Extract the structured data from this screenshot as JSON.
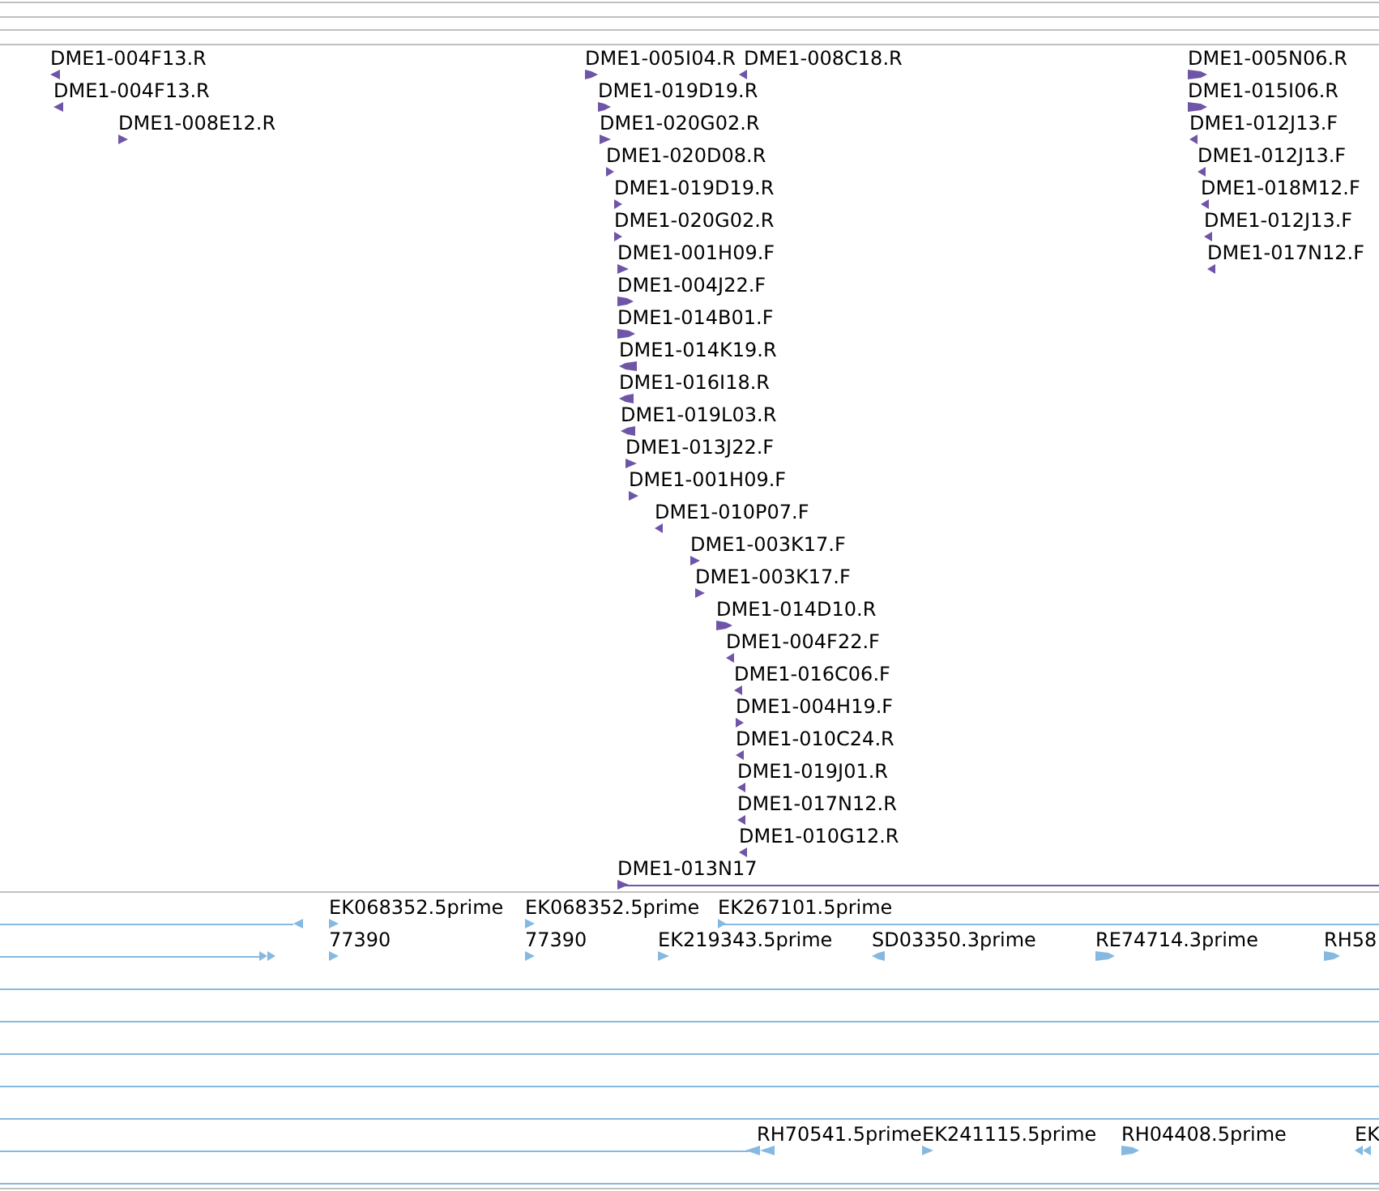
{
  "tracks": [
    {
      "kind": "clone_ends",
      "features": [
        {
          "label": "DME1-004F13.R",
          "reverse": true
        },
        {
          "label": "DME1-005I04.R",
          "reverse": false
        },
        {
          "label": "DME1-008C18.R",
          "reverse": true
        },
        {
          "label": "DME1-005N06.R",
          "reverse": false
        },
        {
          "label": "DME1-004F13.R",
          "reverse": true
        },
        {
          "label": "DME1-019D19.R",
          "reverse": false
        },
        {
          "label": "DME1-015I06.R",
          "reverse": false
        },
        {
          "label": "DME1-008E12.R",
          "reverse": false
        },
        {
          "label": "DME1-020G02.R",
          "reverse": false
        },
        {
          "label": "DME1-012J13.F",
          "reverse": true
        },
        {
          "label": "DME1-020D08.R",
          "reverse": false
        },
        {
          "label": "DME1-012J13.F",
          "reverse": true
        },
        {
          "label": "DME1-019D19.R",
          "reverse": false
        },
        {
          "label": "DME1-018M12.F",
          "reverse": true
        },
        {
          "label": "DME1-020G02.R",
          "reverse": false
        },
        {
          "label": "DME1-012J13.F",
          "reverse": true
        },
        {
          "label": "DME1-001H09.F",
          "reverse": false
        },
        {
          "label": "DME1-017N12.F",
          "reverse": true
        },
        {
          "label": "DME1-004J22.F",
          "reverse": false
        },
        {
          "label": "DME1-014B01.F",
          "reverse": false
        },
        {
          "label": "DME1-014K19.R",
          "reverse": true
        },
        {
          "label": "DME1-016I18.R",
          "reverse": true
        },
        {
          "label": "DME1-019L03.R",
          "reverse": true
        },
        {
          "label": "DME1-013J22.F",
          "reverse": false
        },
        {
          "label": "DME1-001H09.F",
          "reverse": false
        },
        {
          "label": "DME1-010P07.F",
          "reverse": true
        },
        {
          "label": "DME1-003K17.F",
          "reverse": false
        },
        {
          "label": "DME1-003K17.F",
          "reverse": false
        },
        {
          "label": "DME1-014D10.R",
          "reverse": false
        },
        {
          "label": "DME1-004F22.F",
          "reverse": true
        },
        {
          "label": "DME1-016C06.F",
          "reverse": true
        },
        {
          "label": "DME1-004H19.F",
          "reverse": false
        },
        {
          "label": "DME1-010C24.R",
          "reverse": true
        },
        {
          "label": "DME1-019J01.R",
          "reverse": true
        },
        {
          "label": "DME1-017N12.R",
          "reverse": true
        },
        {
          "label": "DME1-010G12.R",
          "reverse": true
        },
        {
          "label": "DME1-013N17",
          "reverse": false
        }
      ]
    },
    {
      "kind": "est",
      "features": [
        {
          "reverse": true
        },
        {
          "label": "EK068352.5prime",
          "reverse": false
        },
        {
          "label": "EK068352.5prime",
          "reverse": false
        },
        {
          "label": "EK267101.5prime",
          "reverse": false
        },
        {
          "reverse": false
        },
        {
          "label": "77390",
          "reverse": false
        },
        {
          "label": "77390",
          "reverse": false
        },
        {
          "label": "EK219343.5prime",
          "reverse": false
        },
        {
          "label": "SD03350.3prime",
          "reverse": true
        },
        {
          "label": "RE74714.3prime",
          "reverse": false
        },
        {
          "label": "RH58",
          "reverse": false
        },
        {
          "label": "RH70541.5prime",
          "reverse": true
        },
        {
          "label": "EK241115.5prime",
          "reverse": false
        },
        {
          "label": "RH04408.5prime",
          "reverse": false
        },
        {
          "label": "EK",
          "reverse": true
        }
      ]
    }
  ]
}
